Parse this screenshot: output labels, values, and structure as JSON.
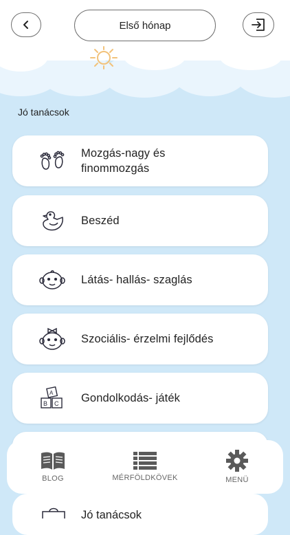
{
  "header": {
    "title": "Első hónap",
    "back_icon": "chevron-left-icon",
    "exit_icon": "exit-icon"
  },
  "section": {
    "label": "Jó tanácsok"
  },
  "cards": [
    {
      "label_line1": "Mozgás-nagy és",
      "label_line2": "finommozgás",
      "icon": "baby-feet-icon"
    },
    {
      "label": "Beszéd",
      "icon": "rubber-duck-icon"
    },
    {
      "label": "Látás- hallás- szaglás",
      "icon": "baby-face-icon"
    },
    {
      "label": "Szociális- érzelmi fejlődés",
      "icon": "baby-girl-face-icon"
    },
    {
      "label": "Gondolkodás- játék",
      "icon": "abc-blocks-icon"
    }
  ],
  "peek_card": {
    "label": "Jó tanácsok"
  },
  "nav": [
    {
      "label": "BLOG",
      "icon": "book-icon"
    },
    {
      "label": "MÉRFÖLDKÖVEK",
      "icon": "list-icon"
    },
    {
      "label": "MENÜ",
      "icon": "gear-icon"
    }
  ],
  "colors": {
    "background": "#cfe8f8",
    "card": "#ffffff",
    "sun": "#f2c27a",
    "nav_icon": "#5a5a5a"
  }
}
